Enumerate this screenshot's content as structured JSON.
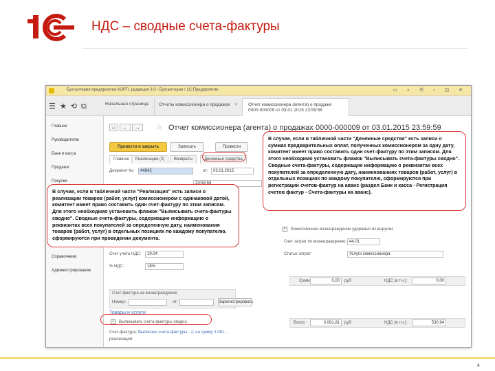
{
  "slide": {
    "title": "НДС – сводные счета-фактуры",
    "page_number": "4",
    "brand_color": "#e6b800",
    "accent_color": "#c41a0f"
  },
  "window": {
    "title": "Бухгалтерия предприятия КОРП, редакция 3.0 / Бухгалтерия / 1С:Предприятие",
    "toolbar_icons": [
      "menu-icon",
      "star-icon",
      "history-icon",
      "copy-icon"
    ],
    "tabs": [
      {
        "label": "Начальная страница"
      },
      {
        "label": "Отчеты комиссионера о продажах"
      },
      {
        "label": "Отчет комиссионера (агента) о продаже",
        "sub": "0000-000009 от 03.01.2015 23:59:58",
        "active": true
      }
    ]
  },
  "sidebar": {
    "items": [
      "Главное",
      "Руководителю",
      "Банк и касса",
      "Продажи",
      "Покупки",
      "Справочники",
      "Администрирование"
    ]
  },
  "document": {
    "title": "Отчет комиссионера (агента) о продажах 0000-000009 от 03.01.2015 23:59:59",
    "buttons": {
      "post_close": "Провести и закрыть",
      "save": "Записать",
      "post": "Провести"
    },
    "subtabs": [
      "Главное",
      "Реализация (2)",
      "Возвраты",
      "Денежные средства"
    ],
    "fields": {
      "doc_no_label": "Документ №:",
      "doc_no_value": "44842",
      "date_label": "от:",
      "date_value": "03.01.2015",
      "date_value_2": "23:59:59",
      "commission_checkbox": "Комиссионное вознаграждение удержано из выручки",
      "account_label": "Счет затрат по вознаграждению:",
      "account_value": "44.01",
      "cost_items_label": "Статьи затрат:",
      "cost_items_value": "Услуги комиссионера",
      "vat_rate_label": "% НДС:",
      "vat_rate_value": "18%",
      "vat_account_label": "Счет учета НДС:",
      "vat_account_value": "19.04",
      "sum_label": "Сумма:",
      "sum_value": "0,00",
      "sum_currency": "руб",
      "vat_label": "НДС (в т.ч.):",
      "vat_value": "0,00",
      "invoice_reward_label": "Счет-фактура на вознаграждение:",
      "number_label": "Номер:",
      "from_label": "от:",
      "register_button": "Зарегистрировать",
      "goods_services_header": "Товары и услуги",
      "issue_invoice_checkbox": "Выписывать счета-фактуры сводно",
      "total_label": "Всего:",
      "total_value": "3 081,81",
      "total_currency": "руб",
      "total_vat_label": "НДС (в т.ч.):",
      "total_vat_value": "530,94",
      "invoice_label": "Счет-фактура:",
      "invoice_link": "Выписано счета-фактуры - 2, на сумму 3 081...",
      "realization_label": "реализация:"
    }
  },
  "callouts": {
    "right": "В случае, если в табличной части \"Денежные средства\" есть записи о суммах предварительных оплат, полученных комиссионером за одну дату, комитент имеет право составить один счет-фактуру по этим записям. Для этого необходимо установить флажок \"Выписывать счета-фактуры сводно\". Сводные счета-фактуры, содержащие информацию о реквизитах всех покупателей за определенную дату, наименованиях товаров (работ, услуг) в отдельных позициях по каждому покупателю, сформируются при регистрации счетов-фактур на аванс (раздел Банк и касса - Регистрация счетов фактур - Счета-фактуры на аванс).",
    "left": "В случае, если в табличной части \"Реализация\" есть записи о реализации товаров (работ, услуг) комиссионером с одинаковой датой, комитент имеет право составить один счет-фактуру по этим записям. Для этого необходимо установить флажок \"Выписывать счета-фактуры сводно\". Сводные счета-фактуры, содержащие информацию о реквизитах всех покупателей за определенную дату, наименования товаров (работ, услуг) в отдельных позициях по каждому покупателю, сформируются при проведении документа."
  }
}
